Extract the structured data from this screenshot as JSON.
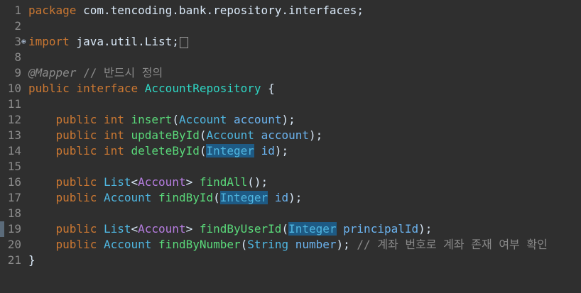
{
  "editor": {
    "lines": [
      {
        "num": "1",
        "parts": [
          [
            "kw",
            "package"
          ],
          [
            "pkg",
            " com.tencoding.bank.repository.interfaces;"
          ]
        ]
      },
      {
        "num": "2",
        "parts": []
      },
      {
        "num": "3",
        "marker": "⊕",
        "parts": [
          [
            "kw",
            "import"
          ],
          [
            "pkg",
            " java.util.List;"
          ]
        ],
        "fold": true
      },
      {
        "num": "8",
        "parts": []
      },
      {
        "num": "9",
        "parts": [
          [
            "anno",
            "@Mapper"
          ],
          [
            "comment",
            " // 반드시 정의"
          ]
        ]
      },
      {
        "num": "10",
        "parts": [
          [
            "kw",
            "public"
          ],
          [
            "pkg",
            " "
          ],
          [
            "kw",
            "interface"
          ],
          [
            "pkg",
            " "
          ],
          [
            "iface",
            "AccountRepository"
          ],
          [
            "pkg",
            " {"
          ]
        ]
      },
      {
        "num": "11",
        "parts": []
      },
      {
        "num": "12",
        "parts": [
          [
            "pkg",
            "    "
          ],
          [
            "kw",
            "public"
          ],
          [
            "pkg",
            " "
          ],
          [
            "kw",
            "int"
          ],
          [
            "pkg",
            " "
          ],
          [
            "method",
            "insert"
          ],
          [
            "pkg",
            "("
          ],
          [
            "cls",
            "Account"
          ],
          [
            "pkg",
            " "
          ],
          [
            "param",
            "account"
          ],
          [
            "pkg",
            ");"
          ]
        ]
      },
      {
        "num": "13",
        "parts": [
          [
            "pkg",
            "    "
          ],
          [
            "kw",
            "public"
          ],
          [
            "pkg",
            " "
          ],
          [
            "kw",
            "int"
          ],
          [
            "pkg",
            " "
          ],
          [
            "method",
            "updateById"
          ],
          [
            "pkg",
            "("
          ],
          [
            "cls",
            "Account"
          ],
          [
            "pkg",
            " "
          ],
          [
            "param",
            "account"
          ],
          [
            "pkg",
            ");"
          ]
        ]
      },
      {
        "num": "14",
        "parts": [
          [
            "pkg",
            "    "
          ],
          [
            "kw",
            "public"
          ],
          [
            "pkg",
            " "
          ],
          [
            "kw",
            "int"
          ],
          [
            "pkg",
            " "
          ],
          [
            "method",
            "deleteById"
          ],
          [
            "pkg",
            "("
          ],
          [
            "hl cls",
            "Integer"
          ],
          [
            "pkg",
            " "
          ],
          [
            "param",
            "id"
          ],
          [
            "pkg",
            ");"
          ]
        ]
      },
      {
        "num": "15",
        "parts": []
      },
      {
        "num": "16",
        "parts": [
          [
            "pkg",
            "    "
          ],
          [
            "kw",
            "public"
          ],
          [
            "pkg",
            " "
          ],
          [
            "cls",
            "List"
          ],
          [
            "pkg",
            "<"
          ],
          [
            "generic",
            "Account"
          ],
          [
            "pkg",
            "> "
          ],
          [
            "method",
            "findAll"
          ],
          [
            "pkg",
            "();"
          ]
        ]
      },
      {
        "num": "17",
        "parts": [
          [
            "pkg",
            "    "
          ],
          [
            "kw",
            "public"
          ],
          [
            "pkg",
            " "
          ],
          [
            "cls",
            "Account"
          ],
          [
            "pkg",
            " "
          ],
          [
            "method",
            "findById"
          ],
          [
            "pkg",
            "("
          ],
          [
            "hl cls",
            "Integer"
          ],
          [
            "pkg",
            " "
          ],
          [
            "param",
            "id"
          ],
          [
            "pkg",
            ");"
          ]
        ]
      },
      {
        "num": "18",
        "parts": []
      },
      {
        "num": "19",
        "current": true,
        "parts": [
          [
            "pkg",
            "    "
          ],
          [
            "kw",
            "public"
          ],
          [
            "pkg",
            " "
          ],
          [
            "cls",
            "List"
          ],
          [
            "pkg",
            "<"
          ],
          [
            "generic",
            "Account"
          ],
          [
            "pkg",
            "> "
          ],
          [
            "method",
            "findByUserId"
          ],
          [
            "pkg",
            "("
          ],
          [
            "hl cls",
            "Integer"
          ],
          [
            "pkg",
            " "
          ],
          [
            "param",
            "principalId"
          ],
          [
            "pkg",
            ");"
          ]
        ]
      },
      {
        "num": "20",
        "parts": [
          [
            "pkg",
            "    "
          ],
          [
            "kw",
            "public"
          ],
          [
            "pkg",
            " "
          ],
          [
            "cls",
            "Account"
          ],
          [
            "pkg",
            " "
          ],
          [
            "method",
            "findByNumber"
          ],
          [
            "pkg",
            "("
          ],
          [
            "cls",
            "String"
          ],
          [
            "pkg",
            " "
          ],
          [
            "param",
            "number"
          ],
          [
            "pkg",
            ");"
          ],
          [
            "comment",
            " // 계좌 번호로 계좌 존재 여부 확인"
          ]
        ]
      },
      {
        "num": "21",
        "parts": [
          [
            "pkg",
            "}"
          ]
        ]
      }
    ],
    "colors": {
      "background": "#2f2f2f",
      "keyword": "#cc7832",
      "type": "#4fb6e0",
      "method": "#5ad97a",
      "generic": "#b67de0",
      "comment": "#8a8a8a",
      "highlight": "#1e5a84"
    }
  }
}
